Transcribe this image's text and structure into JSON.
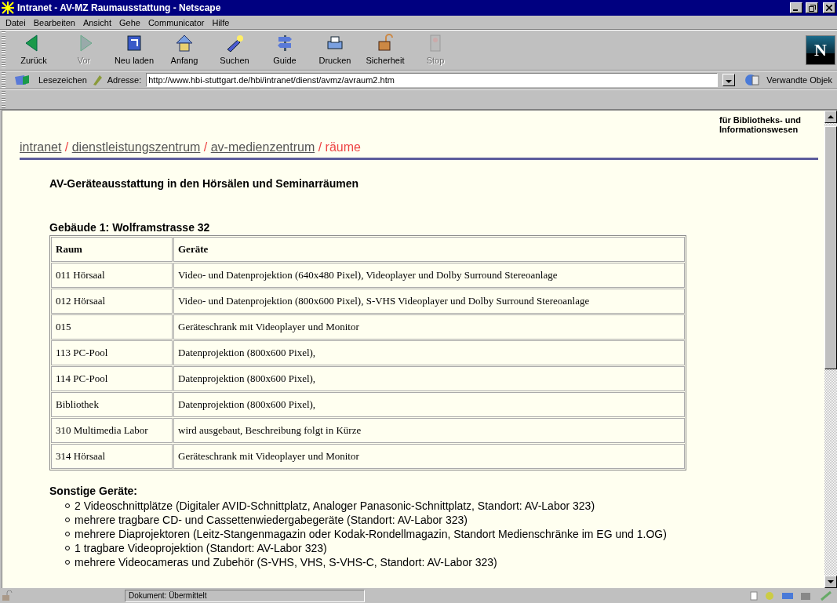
{
  "window": {
    "title": "Intranet - AV-MZ Raumausstattung - Netscape"
  },
  "menu": [
    "Datei",
    "Bearbeiten",
    "Ansicht",
    "Gehe",
    "Communicator",
    "Hilfe"
  ],
  "toolbar": [
    {
      "label": "Zurück",
      "kind": "back",
      "disabled": false
    },
    {
      "label": "Vor",
      "kind": "forward",
      "disabled": true
    },
    {
      "label": "Neu laden",
      "kind": "reload",
      "disabled": false
    },
    {
      "label": "Anfang",
      "kind": "home",
      "disabled": false
    },
    {
      "label": "Suchen",
      "kind": "search",
      "disabled": false
    },
    {
      "label": "Guide",
      "kind": "guide",
      "disabled": false
    },
    {
      "label": "Drucken",
      "kind": "print",
      "disabled": false
    },
    {
      "label": "Sicherheit",
      "kind": "security",
      "disabled": false
    },
    {
      "label": "Stop",
      "kind": "stop",
      "disabled": true
    }
  ],
  "location": {
    "bookmarks": "Lesezeichen",
    "label": "Adresse:",
    "url": "http://www.hbi-stuttgart.de/hbi/intranet/dienst/avmz/avraum2.htm",
    "related": "Verwandte Objek"
  },
  "logo": "N",
  "page": {
    "separator": "/",
    "org": "für Bibliotheks- und Informationswesen",
    "breadcrumb": [
      {
        "label": "intranet",
        "current": false
      },
      {
        "label": "dienstleistungszentrum",
        "current": false
      },
      {
        "label": "av-medienzentrum",
        "current": false
      },
      {
        "label": "räume",
        "current": true
      }
    ],
    "heading": "AV-Geräteausstattung in den Hörsälen und Seminarräumen",
    "building": "Gebäude 1: Wolframstrasse 32",
    "table": {
      "columns": [
        "Raum",
        "Geräte"
      ],
      "rows": [
        [
          "011 Hörsaal",
          "Video- und Datenprojektion (640x480 Pixel), Videoplayer und Dolby Surround Stereoanlage"
        ],
        [
          "012 Hörsaal",
          "Video- und Datenprojektion (800x600 Pixel), S-VHS Videoplayer und Dolby Surround Stereoanlage"
        ],
        [
          "015",
          "Geräteschrank mit Videoplayer und Monitor"
        ],
        [
          "113 PC-Pool",
          "Datenprojektion (800x600 Pixel),"
        ],
        [
          "114 PC-Pool",
          "Datenprojektion (800x600 Pixel),"
        ],
        [
          "Bibliothek",
          "Datenprojektion (800x600 Pixel),"
        ],
        [
          "310 Multimedia Labor",
          "wird ausgebaut, Beschreibung folgt in Kürze"
        ],
        [
          "314 Hörsaal",
          "Geräteschrank mit Videoplayer und Monitor"
        ]
      ]
    },
    "other_heading": "Sonstige Geräte:",
    "other_items": [
      "2 Videoschnittplätze (Digitaler AVID-Schnittplatz, Analoger Panasonic-Schnittplatz, Standort: AV-Labor 323)",
      "mehrere tragbare CD- und Cassettenwiedergabegeräte (Standort: AV-Labor 323)",
      "mehrere Diaprojektoren (Leitz-Stangenmagazin oder Kodak-Rondellmagazin, Standort Medienschränke im EG und 1.OG)",
      "1 tragbare Videoprojektion (Standort: AV-Labor 323)",
      "mehrere Videocameras und Zubehör (S-VHS, VHS, S-VHS-C, Standort: AV-Labor 323)"
    ]
  },
  "status_bar": {
    "text": "Dokument: Übermittelt"
  }
}
